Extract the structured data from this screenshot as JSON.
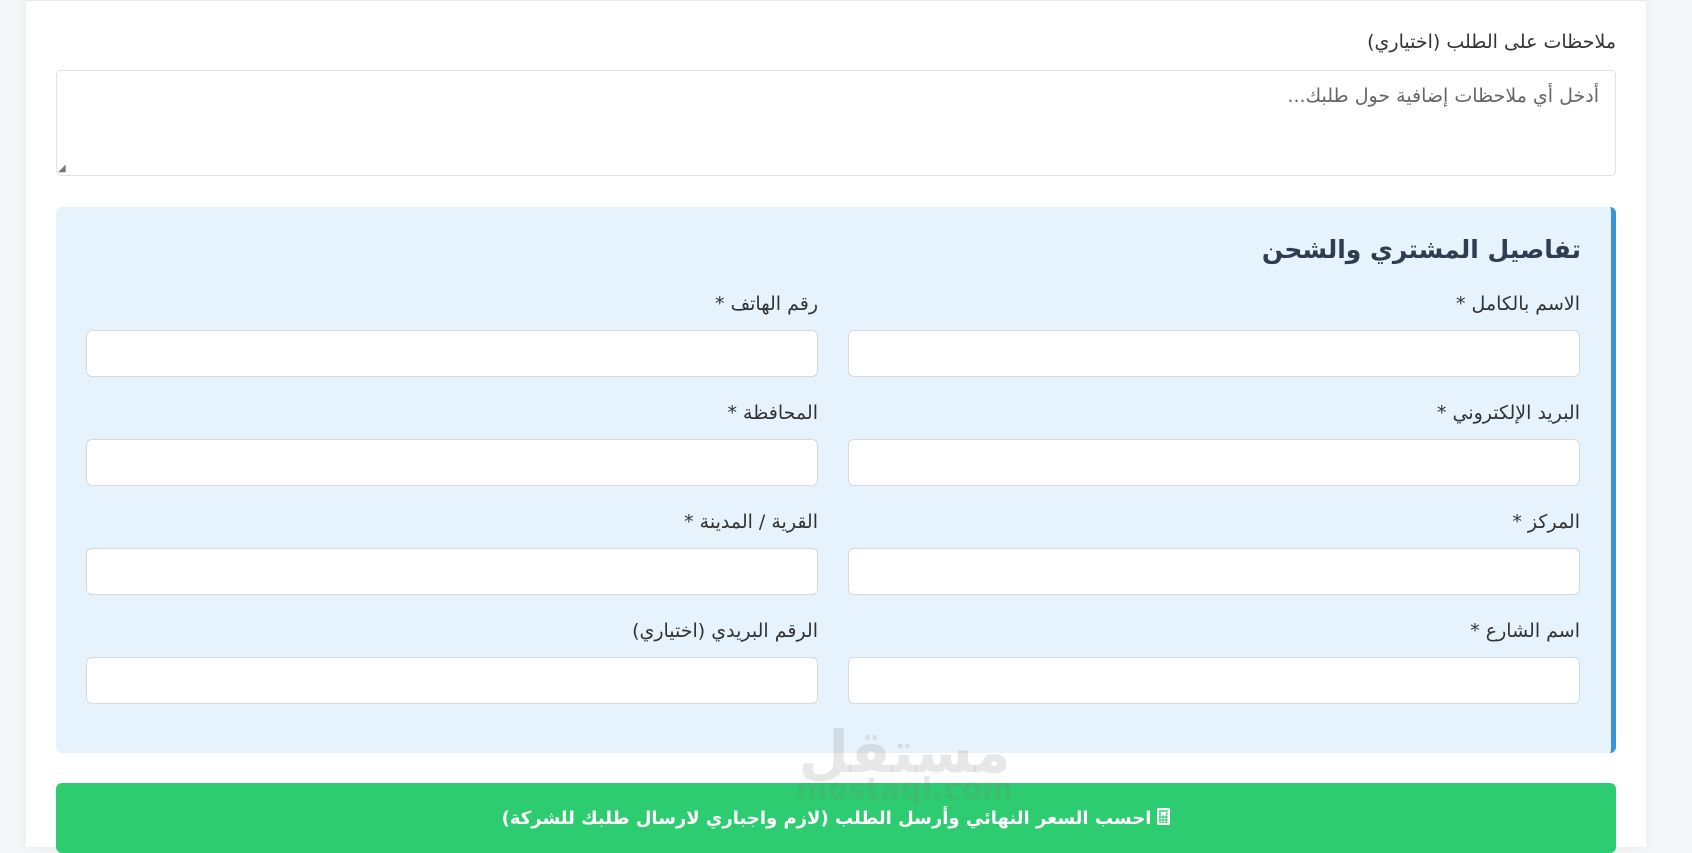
{
  "notes": {
    "label": "ملاحظات على الطلب (اختياري)",
    "placeholder": "أدخل أي ملاحظات إضافية حول طلبك...",
    "value": ""
  },
  "shipping": {
    "title": "تفاصيل المشتري والشحن",
    "fields": {
      "full_name": {
        "label": "الاسم بالكامل *",
        "value": ""
      },
      "phone": {
        "label": "رقم الهاتف *",
        "value": ""
      },
      "email": {
        "label": "البريد الإلكتروني *",
        "value": ""
      },
      "governorate": {
        "label": "المحافظة *",
        "value": ""
      },
      "center": {
        "label": "المركز *",
        "value": ""
      },
      "village_city": {
        "label": "القرية / المدينة *",
        "value": ""
      },
      "street": {
        "label": "اسم الشارع *",
        "value": ""
      },
      "postal_code": {
        "label": "الرقم البريدي (اختياري)",
        "value": ""
      }
    }
  },
  "submit": {
    "label": "احسب السعر النهائي وأرسل الطلب (لازم واجباري لارسال طلبك للشركة)",
    "icon": "calculator-icon"
  },
  "watermark": {
    "arabic": "مستقل",
    "latin": "mostaql.com"
  },
  "colors": {
    "section_bg": "#e6f2fc",
    "section_accent": "#3a93d4",
    "submit_bg": "#2ecc71"
  }
}
